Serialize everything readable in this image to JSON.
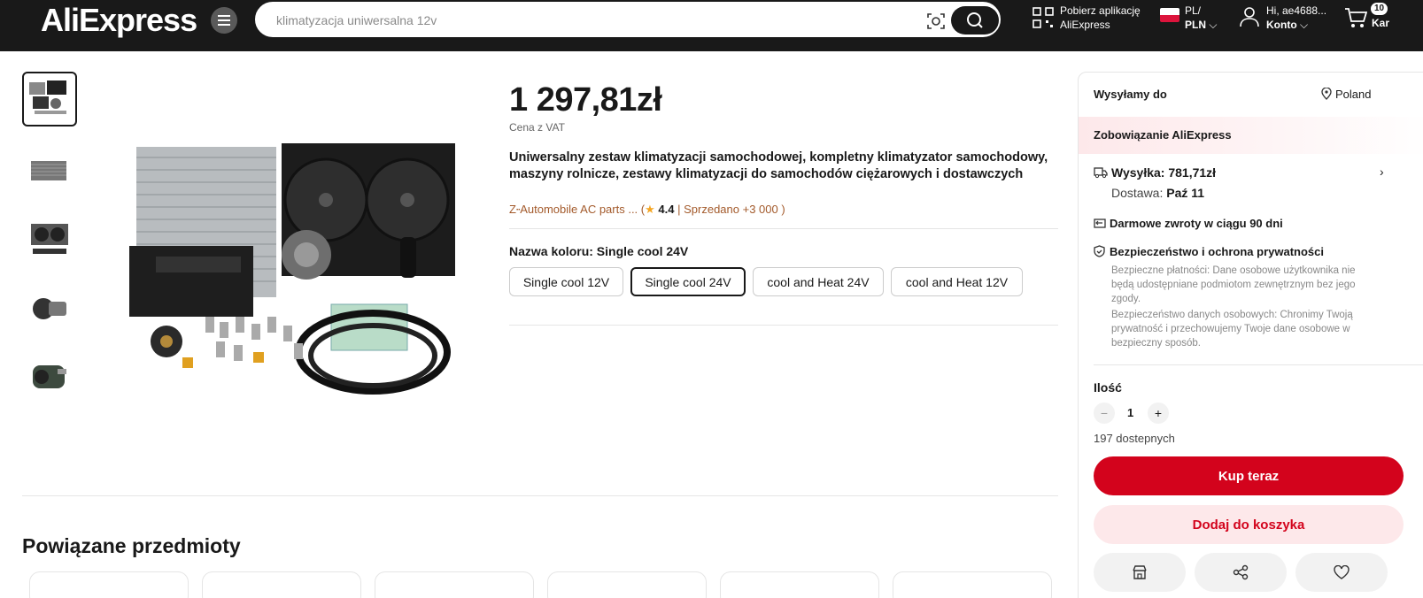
{
  "header": {
    "logo": "AliExpress",
    "search_value": "klimatyzacja uniwersalna 12v",
    "app_line1": "Pobierz aplikację",
    "app_line2": "AliExpress",
    "lang_line1": "PL/",
    "lang_line2": "PLN",
    "user_line1": "Hi, ae4688...",
    "user_line2": "Konto",
    "cart_count": "10",
    "cart_label": "Kar"
  },
  "product": {
    "price": "1 297,81zł",
    "vat_note": "Cena z VAT",
    "title": "Uniwersalny zestaw klimatyzacji samochodowej, kompletny klimatyzator samochodowy, maszyny rolnicze, zestawy klimatyzacji do samochodów ciężarowych i dostawczych",
    "store_prefix": "Z",
    "store_name": "Automobile AC parts ...",
    "store_open": "(",
    "rating": "4.4",
    "sold": "| Sprzedano +3 000 )",
    "color_label": "Nazwa koloru: Single cool 24V",
    "options": [
      "Single cool 12V",
      "Single cool 24V",
      "cool and Heat 24V",
      "cool and Heat 12V"
    ],
    "selected_option": "Single cool 24V"
  },
  "related_title": "Powiązane przedmioty",
  "panel": {
    "ship_to": "Wysyłamy do",
    "country": "Poland",
    "commitment": "Zobowiązanie AliExpress",
    "shipping": "Wysyłka: 781,71zł",
    "delivery_prefix": "Dostawa:",
    "delivery_date": "Paź 11",
    "returns": "Darmowe zwroty w ciągu 90 dni",
    "security": "Bezpieczeństwo i ochrona prywatności",
    "security_desc1": "Bezpieczne płatności: Dane osobowe użytkownika nie będą udostępniane podmiotom zewnętrznym bez jego zgody.",
    "security_desc2": "Bezpieczeństwo danych osobowych: Chronimy Twoją prywatność i przechowujemy Twoje dane osobowe w bezpieczny sposób.",
    "qty_label": "Ilość",
    "minus": "−",
    "qty": "1",
    "plus": "+",
    "available": "197 dostepnych",
    "buy_now": "Kup teraz",
    "add_to_cart": "Dodaj do koszyka"
  },
  "colors": {
    "accent": "#d3031c",
    "header_bg": "#191919",
    "store_link": "#a35a2b"
  }
}
